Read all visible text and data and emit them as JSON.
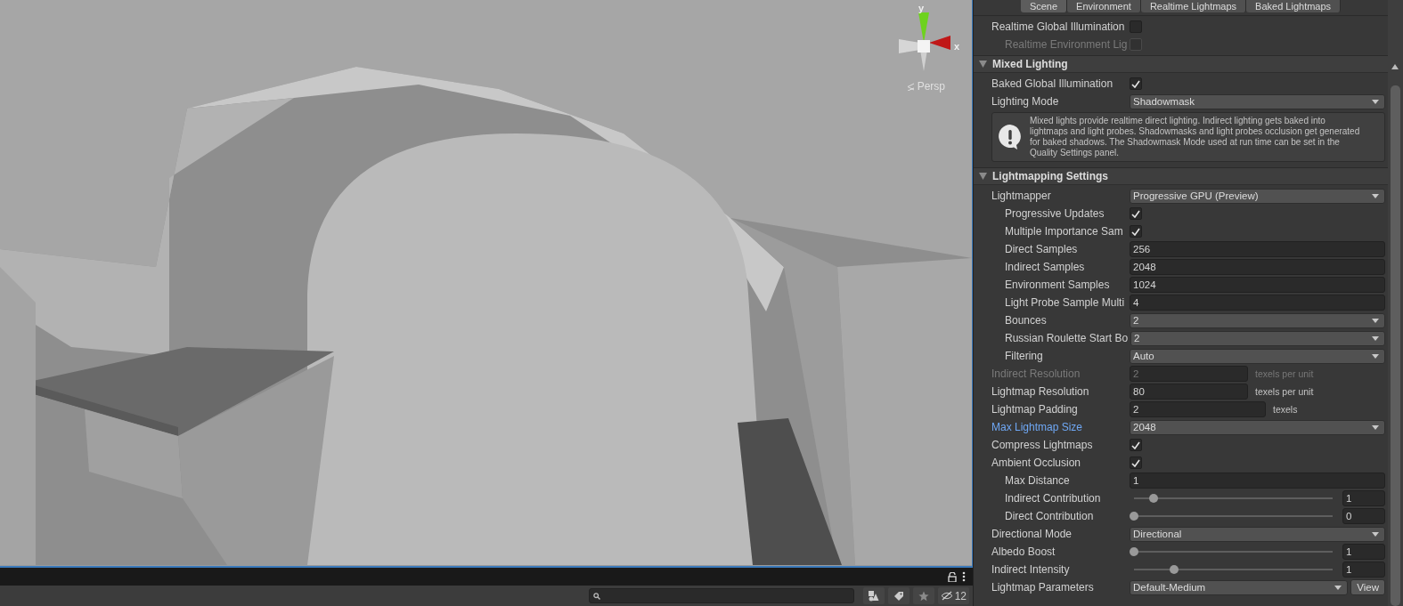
{
  "viewport": {
    "gizmo": {
      "y_label": "y",
      "x_label": "x"
    },
    "projection": "Persp"
  },
  "bottom_bar": {
    "hidden_count": "12"
  },
  "inspector": {
    "tabs": [
      {
        "label": "Scene",
        "selected": true
      },
      {
        "label": "Environment",
        "selected": false
      },
      {
        "label": "Realtime Lightmaps",
        "selected": false
      },
      {
        "label": "Baked Lightmaps",
        "selected": false
      }
    ],
    "top_rows": [
      {
        "kind": "checkbox",
        "label": "Realtime Global Illumination",
        "checked": false,
        "disabled": false,
        "children": [
          {
            "kind": "checkbox",
            "label": "Realtime Environment Lig",
            "checked": false,
            "disabled": true
          }
        ]
      }
    ],
    "sections": [
      {
        "title": "Mixed Lighting",
        "expanded": true,
        "rows": [
          {
            "kind": "checkbox",
            "label": "Baked Global Illumination",
            "checked": true,
            "disabled": false
          },
          {
            "kind": "dropdown",
            "label": "Lighting Mode",
            "value": "Shadowmask",
            "disabled": false
          },
          {
            "kind": "helpbox",
            "text": "Mixed lights provide realtime direct lighting. Indirect lighting gets baked into lightmaps and light probes. Shadowmasks and light probes occlusion get generated for baked shadows. The Shadowmask Mode used at run time can be set in the Quality Settings panel."
          }
        ]
      },
      {
        "title": "Lightmapping Settings",
        "expanded": true,
        "rows": [
          {
            "kind": "dropdown",
            "label": "Lightmapper",
            "value": "Progressive GPU (Preview)",
            "disabled": false,
            "children": [
              {
                "kind": "checkbox",
                "label": "Progressive Updates",
                "checked": true,
                "disabled": false
              },
              {
                "kind": "checkbox",
                "label": "Multiple Importance Sam",
                "checked": true,
                "disabled": false
              },
              {
                "kind": "field",
                "label": "Direct Samples",
                "value": "256",
                "disabled": false
              },
              {
                "kind": "field",
                "label": "Indirect Samples",
                "value": "2048",
                "disabled": false
              },
              {
                "kind": "field",
                "label": "Environment Samples",
                "value": "1024",
                "disabled": false
              },
              {
                "kind": "field",
                "label": "Light Probe Sample Multi",
                "value": "4",
                "disabled": false
              },
              {
                "kind": "dropdown",
                "label": "Bounces",
                "value": "2",
                "disabled": false
              },
              {
                "kind": "dropdown",
                "label": "Russian Roulette Start Bo",
                "value": "2",
                "disabled": false
              },
              {
                "kind": "dropdown",
                "label": "Filtering",
                "value": "Auto",
                "disabled": false
              }
            ]
          },
          {
            "kind": "unit_field",
            "label": "Indirect Resolution",
            "value": "2",
            "unit": "texels per unit",
            "disabled": true
          },
          {
            "kind": "unit_field",
            "label": "Lightmap Resolution",
            "value": "80",
            "unit": "texels per unit",
            "disabled": false
          },
          {
            "kind": "unit_field",
            "label": "Lightmap Padding",
            "value": "2",
            "unit": "texels",
            "disabled": false
          },
          {
            "kind": "dropdown",
            "label": "Max Lightmap Size",
            "value": "2048",
            "disabled": false,
            "highlighted": true
          },
          {
            "kind": "checkbox",
            "label": "Compress Lightmaps",
            "checked": true,
            "disabled": false
          },
          {
            "kind": "checkbox",
            "label": "Ambient Occlusion",
            "checked": true,
            "disabled": false,
            "children": [
              {
                "kind": "field",
                "label": "Max Distance",
                "value": "1",
                "disabled": false
              },
              {
                "kind": "slider",
                "label": "Indirect Contribution",
                "level": 0.1,
                "value": "1",
                "disabled": false
              },
              {
                "kind": "slider",
                "label": "Direct Contribution",
                "level": 0,
                "value": "0",
                "disabled": false
              }
            ]
          },
          {
            "kind": "dropdown",
            "label": "Directional Mode",
            "value": "Directional",
            "disabled": false
          },
          {
            "kind": "slider",
            "label": "Albedo Boost",
            "level": 0,
            "value": "1",
            "disabled": false
          },
          {
            "kind": "slider",
            "label": "Indirect Intensity",
            "level": 0.2,
            "value": "1",
            "disabled": false
          },
          {
            "kind": "dropdown_button",
            "label": "Lightmap Parameters",
            "value": "Default-Medium",
            "button": "View",
            "disabled": false
          }
        ]
      }
    ]
  }
}
